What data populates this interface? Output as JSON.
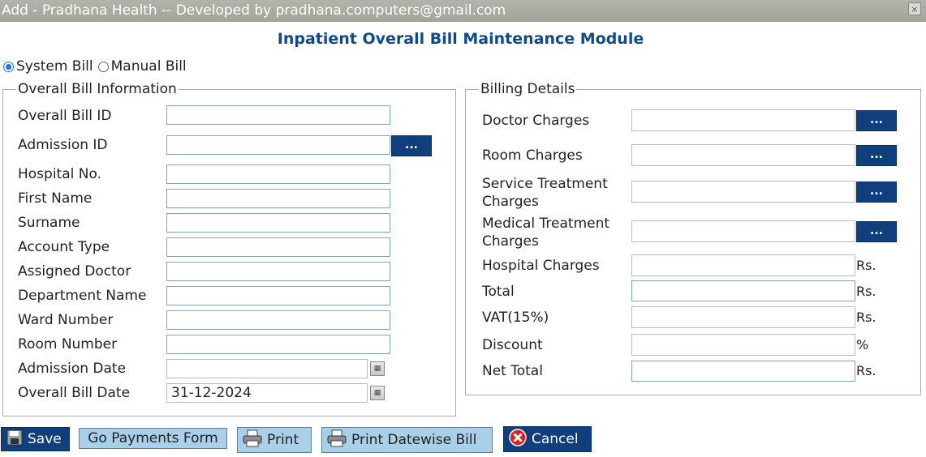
{
  "window": {
    "title": "Add - Pradhana Health -- Developed by pradhana.computers@gmail.com",
    "close": "×"
  },
  "heading": "Inpatient Overall Bill Maintenance Module",
  "bill_type": {
    "options": [
      "System Bill",
      "Manual Bill"
    ],
    "selected": "System Bill"
  },
  "overall_info": {
    "legend": "Overall Bill Information",
    "fields": [
      {
        "label": "Overall Bill ID",
        "value": ""
      },
      {
        "label": "Admission ID",
        "value": ""
      },
      {
        "label": "Hospital No.",
        "value": ""
      },
      {
        "label": "First Name",
        "value": ""
      },
      {
        "label": "Surname",
        "value": ""
      },
      {
        "label": "Account Type",
        "value": ""
      },
      {
        "label": "Assigned Doctor",
        "value": ""
      },
      {
        "label": "Department Name",
        "value": ""
      },
      {
        "label": "Ward Number",
        "value": ""
      },
      {
        "label": "Room Number",
        "value": ""
      },
      {
        "label": "Admission Date",
        "value": ""
      },
      {
        "label": "Overall Bill Date",
        "value": "31-12-2024"
      }
    ],
    "lookup_label": "..."
  },
  "billing": {
    "legend": "Billing Details",
    "lookup_label": "...",
    "rows": [
      {
        "label": "Doctor Charges",
        "value": ""
      },
      {
        "label": "Room Charges",
        "value": ""
      },
      {
        "label": "Service Treatment Charges",
        "value": ""
      },
      {
        "label": "Medical Treatment Charges",
        "value": ""
      },
      {
        "label": "Hospital Charges",
        "value": "",
        "unit": "Rs."
      },
      {
        "label": "Total",
        "value": "",
        "unit": "Rs."
      },
      {
        "label": "VAT(15%)",
        "value": "",
        "unit": "Rs."
      },
      {
        "label": "Discount",
        "value": "",
        "unit": "%"
      },
      {
        "label": "Net Total",
        "value": "",
        "unit": "Rs."
      }
    ]
  },
  "buttons": {
    "save": "Save",
    "payments": "Go Payments Form",
    "print": "Print",
    "print_datewise": "Print Datewise Bill",
    "cancel": "Cancel"
  }
}
